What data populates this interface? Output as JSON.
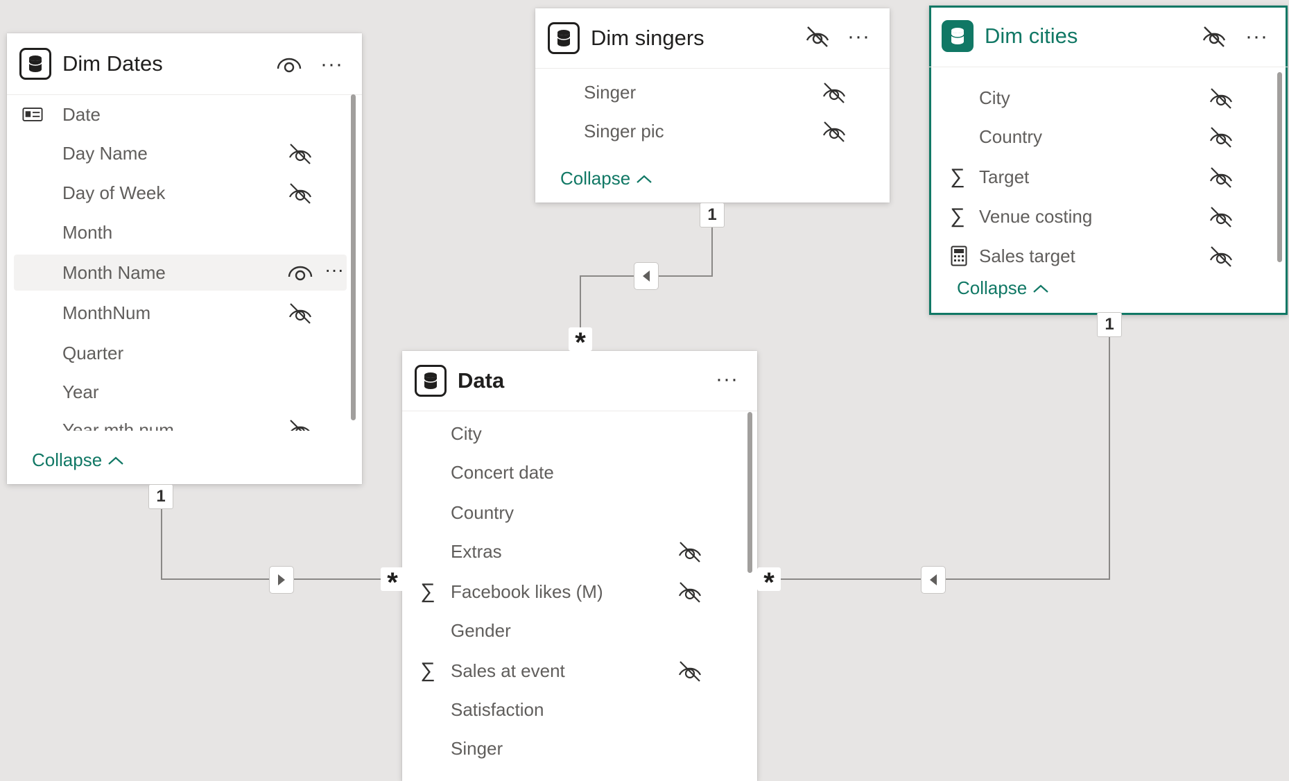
{
  "tables": {
    "dim_dates": {
      "title": "Dim Dates",
      "fields": [
        {
          "name": "Date",
          "icon": "id-card-icon",
          "hidden": false
        },
        {
          "name": "Day Name",
          "hidden": true
        },
        {
          "name": "Day of Week",
          "hidden": true
        },
        {
          "name": "Month",
          "hidden": false
        },
        {
          "name": "Month Name",
          "hidden": false,
          "highlighted": true
        },
        {
          "name": "MonthNum",
          "hidden": true
        },
        {
          "name": "Quarter",
          "hidden": false
        },
        {
          "name": "Year",
          "hidden": false
        },
        {
          "name": "Year mth num",
          "hidden": true
        }
      ],
      "collapse_label": "Collapse"
    },
    "dim_singers": {
      "title": "Dim singers",
      "fields": [
        {
          "name": "Singer",
          "hidden": true
        },
        {
          "name": "Singer pic",
          "hidden": true
        }
      ],
      "collapse_label": "Collapse"
    },
    "dim_cities": {
      "title": "Dim cities",
      "selected": true,
      "fields": [
        {
          "name": "City",
          "hidden": true
        },
        {
          "name": "Country",
          "hidden": true
        },
        {
          "name": "Target",
          "icon": "sigma-icon",
          "hidden": true
        },
        {
          "name": "Venue costing",
          "icon": "sigma-icon",
          "hidden": true
        },
        {
          "name": "Sales target",
          "icon": "calculator-icon",
          "hidden": true
        }
      ],
      "collapse_label": "Collapse"
    },
    "data": {
      "title": "Data",
      "fields": [
        {
          "name": "City",
          "hidden": false
        },
        {
          "name": "Concert date",
          "hidden": false
        },
        {
          "name": "Country",
          "hidden": false
        },
        {
          "name": "Extras",
          "hidden": true
        },
        {
          "name": "Facebook likes (M)",
          "icon": "sigma-icon",
          "hidden": true
        },
        {
          "name": "Gender",
          "hidden": false
        },
        {
          "name": "Sales at event",
          "icon": "sigma-icon",
          "hidden": true
        },
        {
          "name": "Satisfaction",
          "hidden": false
        },
        {
          "name": "Singer",
          "hidden": false
        }
      ]
    }
  },
  "relationships": [
    {
      "from": "Dim Dates",
      "to": "Data",
      "one_label": "1",
      "many_label": "*"
    },
    {
      "from": "Dim singers",
      "to": "Data",
      "one_label": "1",
      "many_label": "*"
    },
    {
      "from": "Dim cities",
      "to": "Data",
      "one_label": "1",
      "many_label": "*"
    }
  ],
  "colors": {
    "accent": "#117865",
    "background": "#e7e5e4",
    "line": "#8a8886"
  }
}
